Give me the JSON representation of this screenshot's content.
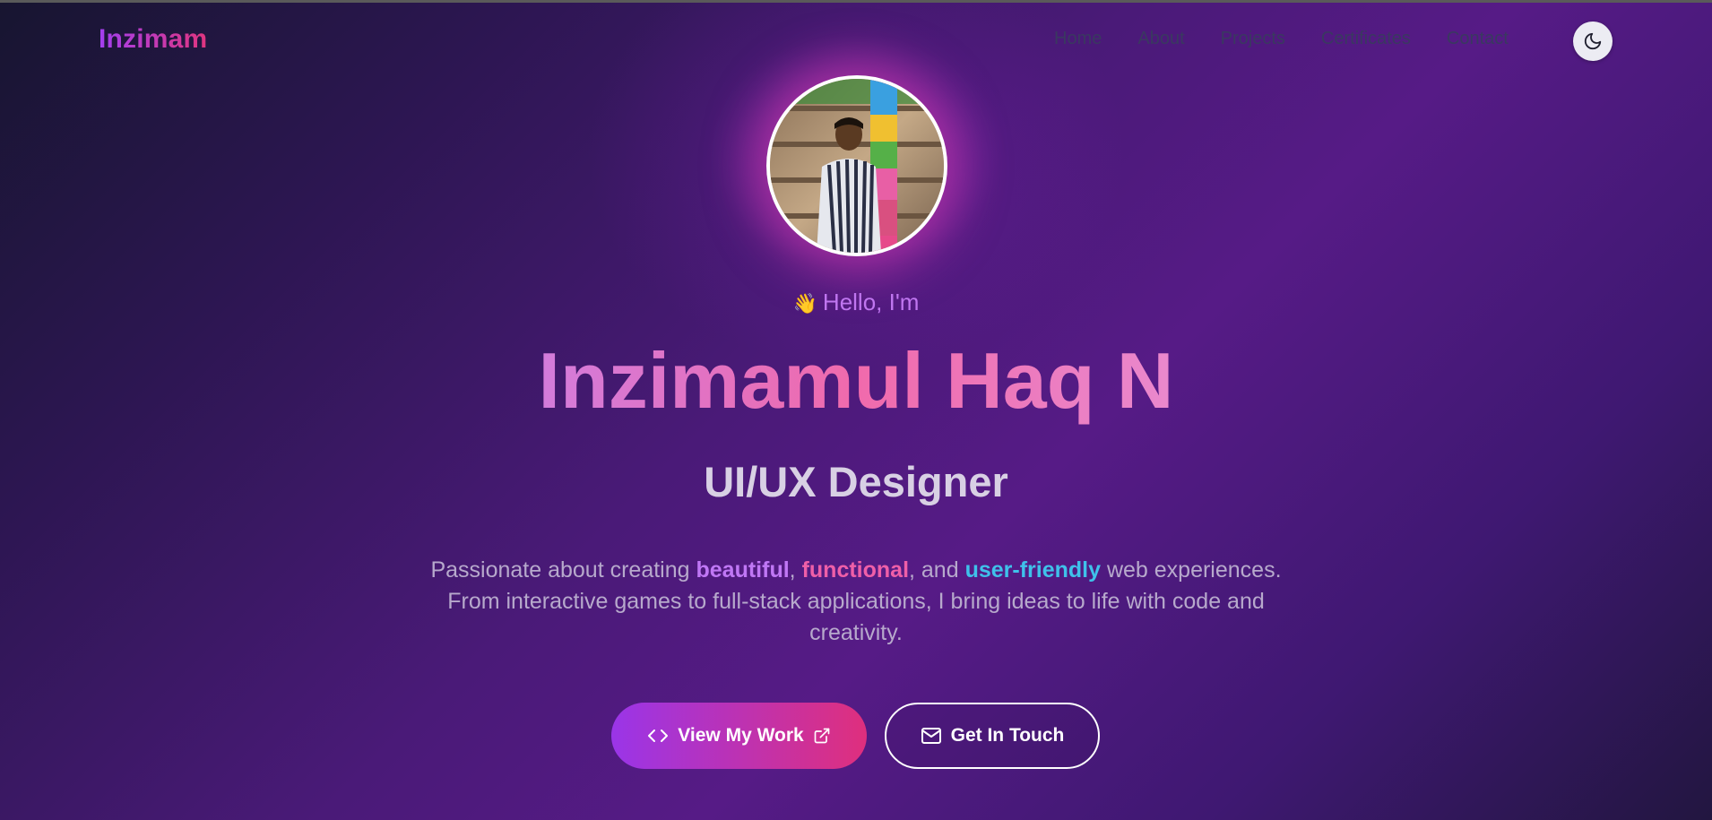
{
  "header": {
    "logo": "Inzimam",
    "nav": [
      {
        "label": "Home"
      },
      {
        "label": "About"
      },
      {
        "label": "Projects"
      },
      {
        "label": "Certificates"
      },
      {
        "label": "Contact"
      }
    ],
    "theme_toggle_icon": "moon-icon"
  },
  "hero": {
    "avatar_icon": "profile-photo",
    "greeting_emoji": "👋",
    "greeting": "Hello, I'm",
    "name": "Inzimamul Haq N",
    "role": "UI/UX Designer",
    "description": {
      "part1": "Passionate about creating ",
      "highlight1": "beautiful",
      "part2": ", ",
      "highlight2": "functional",
      "part3": ", and ",
      "highlight3": "user-friendly",
      "part4": " web experiences. From interactive games to full-stack applications, I bring ideas to life with code and creativity."
    },
    "buttons": {
      "primary_label": "View My Work",
      "secondary_label": "Get In Touch"
    }
  },
  "colors": {
    "accent_purple": "#a33ff0",
    "accent_pink": "#e0357f",
    "highlight_cyan": "#3fc1ea"
  }
}
